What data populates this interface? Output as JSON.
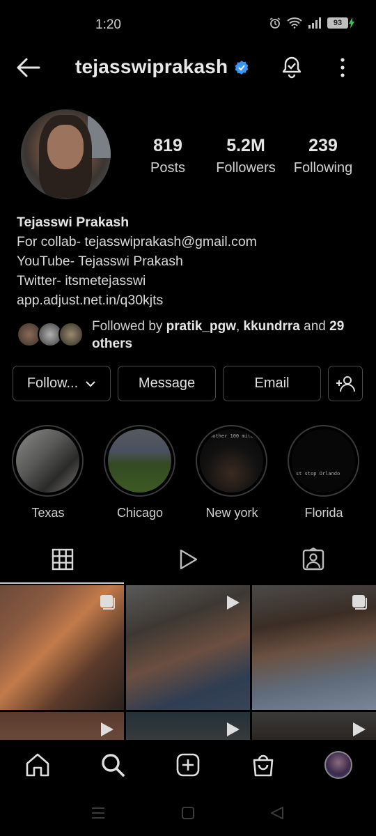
{
  "status": {
    "time": "1:20",
    "battery": "93"
  },
  "header": {
    "username": "tejasswiprakash"
  },
  "stats": [
    {
      "value": "819",
      "label": "Posts"
    },
    {
      "value": "5.2M",
      "label": "Followers"
    },
    {
      "value": "239",
      "label": "Following"
    }
  ],
  "bio": {
    "name": "Tejasswi Prakash",
    "line1": "For collab- tejasswiprakash@gmail.com",
    "line2": "YouTube- Tejasswi Prakash",
    "line3": "Twitter- itsmetejasswi",
    "link": "app.adjust.net.in/q30kjts"
  },
  "followed_by": {
    "prefix": "Followed by ",
    "user1": "pratik_pgw",
    "sep": ", ",
    "user2": "kkundrra",
    "mid": " and ",
    "count": "29",
    "suffix": "others"
  },
  "buttons": {
    "follow": "Follow...",
    "message": "Message",
    "email": "Email"
  },
  "highlights": [
    {
      "label": "Texas",
      "overlay": ""
    },
    {
      "label": "Chicago",
      "overlay": ""
    },
    {
      "label": "New york",
      "overlay": "nother 100 mile"
    },
    {
      "label": "Florida",
      "overlay": "st stop Orlando"
    }
  ],
  "colors": {
    "verified": "#3897f0",
    "background": "#000000",
    "text": "#e6e6e6"
  },
  "icons": [
    "back-arrow-icon",
    "verified-badge-icon",
    "bell-icon",
    "more-icon",
    "chevron-down-icon",
    "add-person-icon",
    "grid-icon",
    "reels-icon",
    "tagged-icon",
    "home-icon",
    "search-icon",
    "create-icon",
    "shop-icon",
    "profile-avatar"
  ]
}
